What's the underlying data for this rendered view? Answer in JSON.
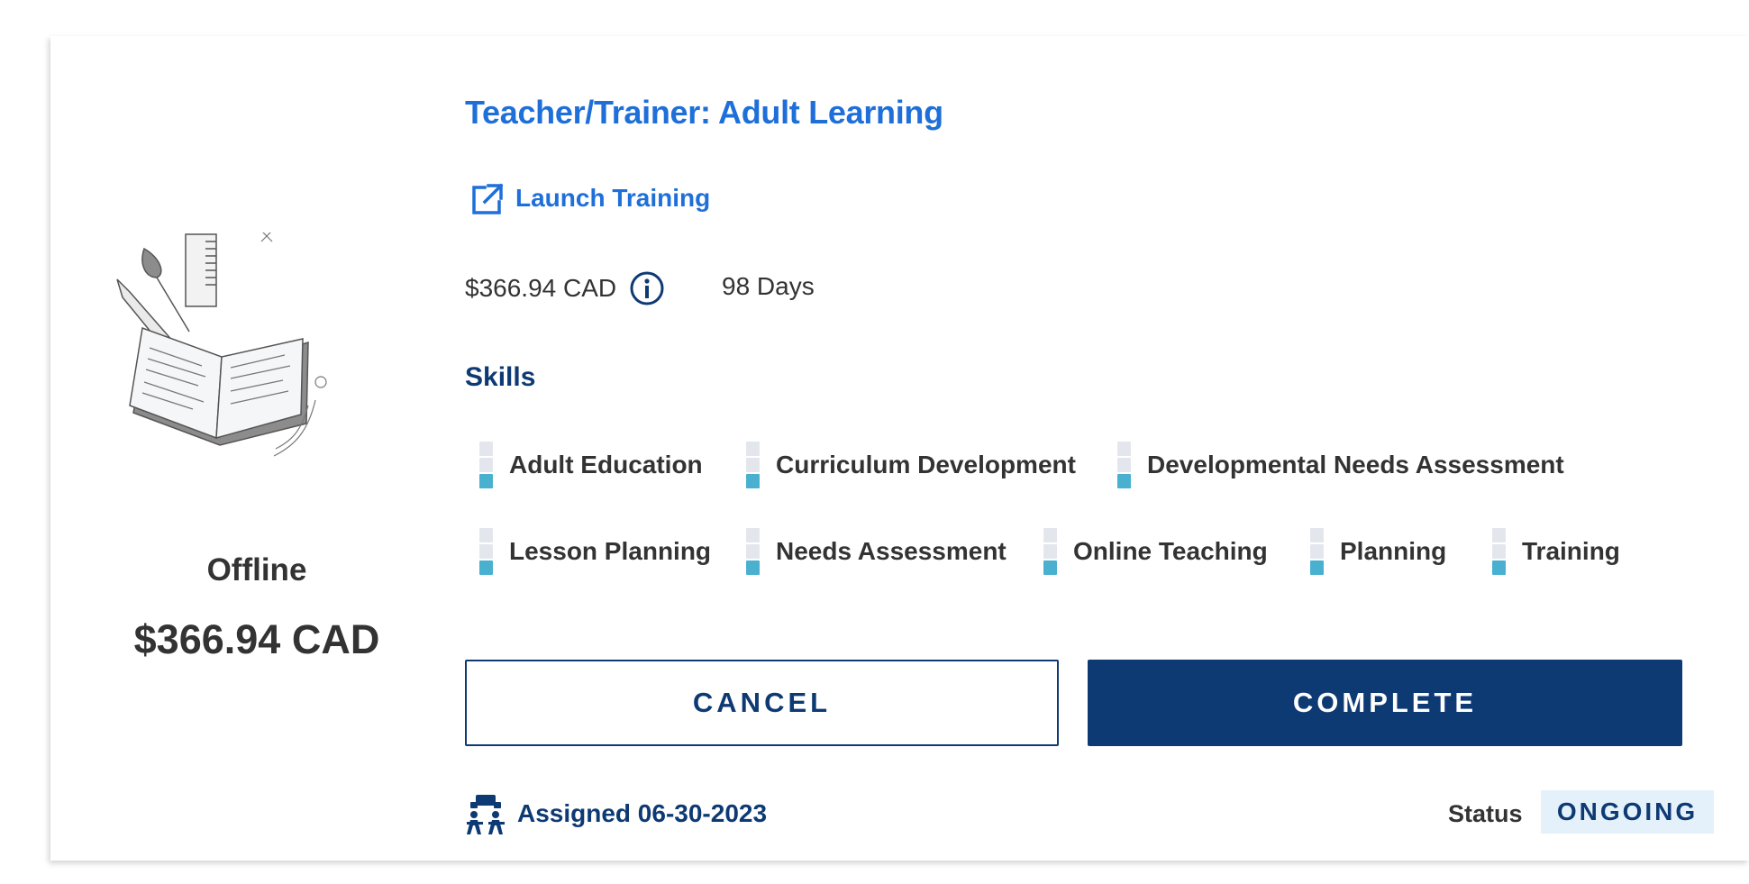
{
  "course": {
    "title": "Teacher/Trainer: Adult Learning",
    "launch_label": "Launch Training",
    "price": "$366.94 CAD",
    "duration": "98 Days",
    "mode": "Offline",
    "price_large": "$366.94 CAD"
  },
  "skills": {
    "heading": "Skills",
    "items": [
      {
        "label": "Adult Education",
        "level": 1,
        "max_level": 3
      },
      {
        "label": "Curriculum Development",
        "level": 1,
        "max_level": 3
      },
      {
        "label": "Developmental Needs Assessment",
        "level": 1,
        "max_level": 3
      },
      {
        "label": "Lesson Planning",
        "level": 1,
        "max_level": 3
      },
      {
        "label": "Needs Assessment",
        "level": 1,
        "max_level": 3
      },
      {
        "label": "Online Teaching",
        "level": 1,
        "max_level": 3
      },
      {
        "label": "Planning",
        "level": 1,
        "max_level": 3
      },
      {
        "label": "Training",
        "level": 1,
        "max_level": 3
      }
    ]
  },
  "actions": {
    "cancel_label": "CANCEL",
    "complete_label": "COMPLETE"
  },
  "footer": {
    "assigned": "Assigned 06-30-2023",
    "status_label": "Status",
    "status_value": "ONGOING"
  },
  "colors": {
    "link_blue": "#1e6fd9",
    "navy": "#0e3a74",
    "skill_fill": "#49b1cf",
    "badge_bg": "#e4f1fb"
  },
  "icons": {
    "launch": "external-link-icon",
    "info": "info-circle-icon",
    "assigned": "classroom-icon",
    "illustration": "book-illustration"
  }
}
